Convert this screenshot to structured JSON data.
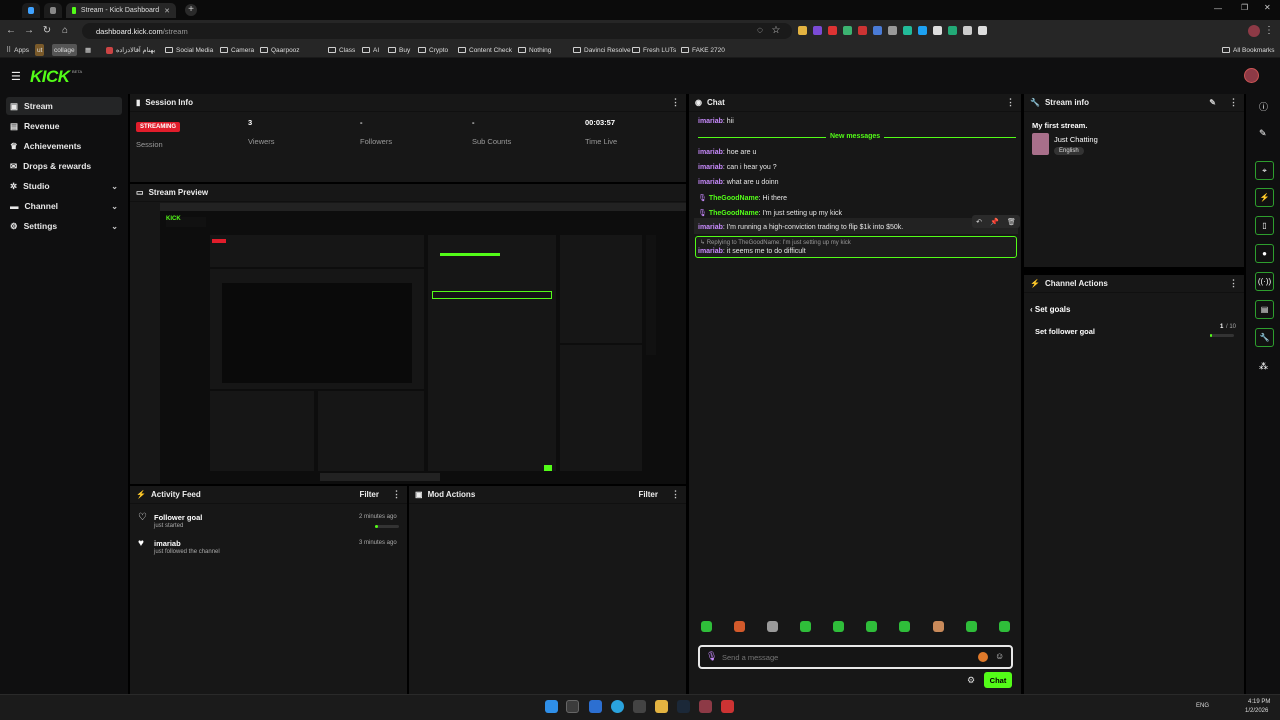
{
  "browser": {
    "tab_title": "Stream - Kick Dashboard",
    "url_host": "dashboard.kick.com",
    "url_path": "/stream",
    "bookmarks": [
      "Apps",
      "ut",
      "collage",
      "بهنام آقالادزاده",
      "Social Media",
      "Camera",
      "Qaarpooz",
      "Class",
      "AI",
      "Buy",
      "Crypto",
      "Content Check",
      "Nothing",
      "Davinci Resolve",
      "Fresh LUTs",
      "FAKE 2720"
    ],
    "all_bookmarks": "All Bookmarks"
  },
  "app": {
    "logo": "KICK",
    "logo_tag": "BETA"
  },
  "sidebar": {
    "items": [
      {
        "label": "Stream",
        "icon": "video-icon",
        "active": true
      },
      {
        "label": "Revenue",
        "icon": "wallet-icon"
      },
      {
        "label": "Achievements",
        "icon": "trophy-icon"
      },
      {
        "label": "Drops & rewards",
        "icon": "gift-icon"
      },
      {
        "label": "Studio",
        "icon": "studio-icon",
        "expandable": true
      },
      {
        "label": "Channel",
        "icon": "channel-icon",
        "expandable": true
      },
      {
        "label": "Settings",
        "icon": "gear-icon",
        "expandable": true
      }
    ]
  },
  "session": {
    "title": "Session Info",
    "status_badge": "STREAMING",
    "stats": [
      {
        "value": "",
        "label": "Session"
      },
      {
        "value": "3",
        "label": "Viewers"
      },
      {
        "value": "-",
        "label": "Followers"
      },
      {
        "value": "-",
        "label": "Sub Counts"
      },
      {
        "value": "00:03:57",
        "label": "Time Live"
      }
    ]
  },
  "preview": {
    "title": "Stream Preview"
  },
  "activity": {
    "title": "Activity Feed",
    "filter": "Filter",
    "items": [
      {
        "title": "Follower goal",
        "sub": "just started",
        "time": "2 minutes ago"
      },
      {
        "title": "imariab",
        "sub": "just followed the channel",
        "time": "3 minutes ago"
      }
    ]
  },
  "mod": {
    "title": "Mod Actions",
    "filter": "Filter"
  },
  "chat": {
    "title": "Chat",
    "new_messages": "New messages",
    "messages": [
      {
        "user": "imariab",
        "text": ": hii"
      },
      {
        "user": "imariab",
        "text": ": hoe are u"
      },
      {
        "user": "imariab",
        "text": ": can i hear you ?"
      },
      {
        "user": "imariab",
        "text": ": what are u doinn"
      },
      {
        "user": "TheGoodName",
        "text": ": Hi there"
      },
      {
        "user": "TheGoodName",
        "text": ": I'm just setting up my kick"
      },
      {
        "user": "imariab",
        "text": ": I'm running a high-conviction trading to flip $1k into $50k."
      }
    ],
    "reply_to": "Replying to TheGoodName: I'm just setting up my kick",
    "reply_user": "imariab",
    "reply_text": ": it seems me to do difficult",
    "input_placeholder": "Send a message",
    "send_label": "Chat"
  },
  "stream_info": {
    "title": "Stream info",
    "stream_title": "My first stream.",
    "category": "Just Chatting",
    "language": "English"
  },
  "channel_actions": {
    "title": "Channel Actions",
    "back_label": "Set goals",
    "goal_label": "Set follower goal",
    "goal_current": "1",
    "goal_total": "/ 10",
    "goal_progress": 0.1
  },
  "taskbar": {
    "lang": "ENG",
    "time": "4:19 PM",
    "date": "1/2/2026"
  },
  "colors": {
    "accent": "#53fc18",
    "streaming": "#e11d2b",
    "chat_user": "#c98bff"
  }
}
